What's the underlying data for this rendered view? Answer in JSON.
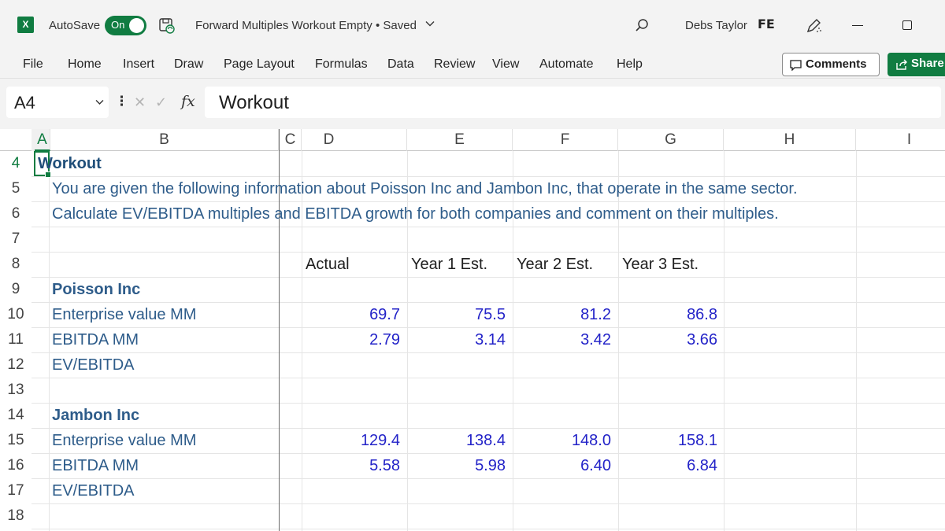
{
  "titlebar": {
    "app_logo": "X",
    "autosave_label": "AutoSave",
    "autosave_state": "On",
    "document_title": "Forward Multiples Workout Empty",
    "save_status": "Saved",
    "user_name": "Debs Taylor",
    "user_initials": "FE"
  },
  "menu": {
    "items": [
      "File",
      "Home",
      "Insert",
      "Draw",
      "Page Layout",
      "Formulas",
      "Data",
      "Review",
      "View",
      "Automate",
      "Help"
    ],
    "comments_label": "Comments",
    "share_label": "Share"
  },
  "formula_bar": {
    "name_box": "A4",
    "fx_label": "fx",
    "content": "Workout"
  },
  "grid": {
    "columns": [
      "A",
      "B",
      "C",
      "D",
      "E",
      "F",
      "G",
      "H",
      "I"
    ],
    "active_column": "A",
    "rows": [
      "4",
      "5",
      "6",
      "7",
      "8",
      "9",
      "10",
      "11",
      "12",
      "13",
      "14",
      "15",
      "16",
      "17",
      "18"
    ],
    "active_row": "4",
    "title": "Workout",
    "instruction_1": "You are given the following information about Poisson Inc and Jambon Inc, that operate in the same sector.",
    "instruction_2": "Calculate EV/EBITDA multiples and EBITDA growth for both companies and comment on their multiples.",
    "period_headers": [
      "Actual",
      "Year 1 Est.",
      "Year 2 Est.",
      "Year 3 Est."
    ],
    "companies": [
      {
        "name": "Poisson Inc",
        "ev_label": "Enterprise value MM",
        "ev_values": [
          "69.7",
          "75.5",
          "81.2",
          "86.8"
        ],
        "ebitda_label": "EBITDA MM",
        "ebitda_values": [
          "2.79",
          "3.14",
          "3.42",
          "3.66"
        ],
        "multiple_label": "EV/EBITDA"
      },
      {
        "name": "Jambon Inc",
        "ev_label": "Enterprise value MM",
        "ev_values": [
          "129.4",
          "138.4",
          "148.0",
          "158.1"
        ],
        "ebitda_label": "EBITDA MM",
        "ebitda_values": [
          "5.58",
          "5.98",
          "6.40",
          "6.84"
        ],
        "multiple_label": "EV/EBITDA"
      }
    ]
  }
}
